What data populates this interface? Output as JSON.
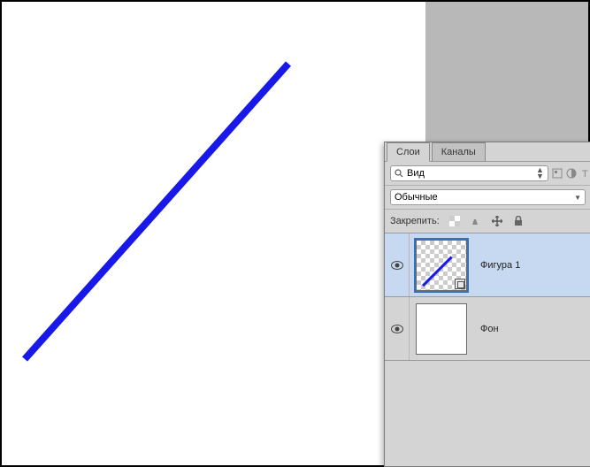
{
  "tabs": {
    "layers": "Слои",
    "channels": "Каналы"
  },
  "search": {
    "placeholder": "Вид"
  },
  "blend": {
    "mode": "Обычные"
  },
  "lock": {
    "label": "Закрепить:"
  },
  "layers": [
    {
      "name": "Фигура 1"
    },
    {
      "name": "Фон"
    }
  ],
  "icons": {
    "filter": "filter-icon",
    "dropdown": "chevron-down-icon",
    "search": "search-icon"
  }
}
